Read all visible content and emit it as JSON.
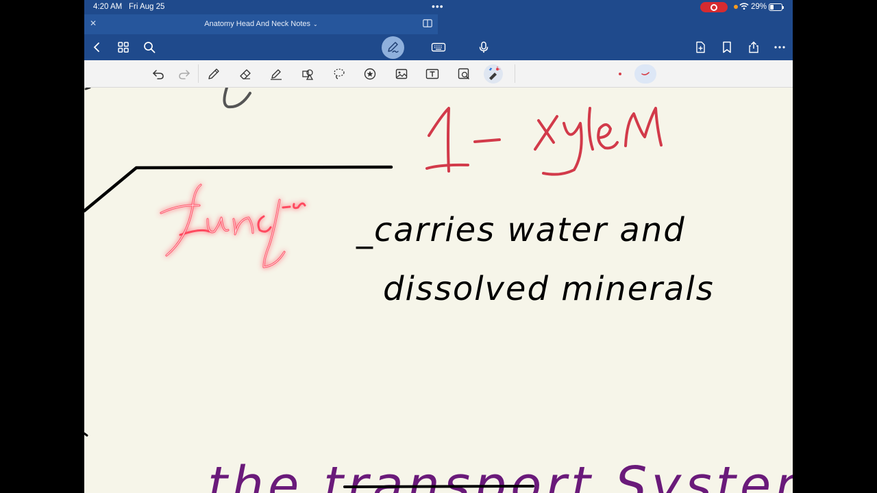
{
  "status_bar": {
    "time": "4:20 AM",
    "date": "Fri Aug 25",
    "battery_percent": "29%",
    "battery_level": 0.29,
    "recording_color": "#d62b30"
  },
  "tab": {
    "title": "Anatomy Head And Neck Notes",
    "close_icon": "close-icon",
    "chevron_icon": "chevron-down-icon"
  },
  "navbar": {
    "icons": [
      "back-icon",
      "grid-icon",
      "search-icon",
      "pen-mode-icon",
      "keyboard-icon",
      "microphone-icon",
      "add-page-icon",
      "bookmark-icon",
      "share-icon",
      "more-icon"
    ],
    "active_mode": "pen",
    "accent": "#1f4a8c"
  },
  "toolbar": {
    "tools": [
      "undo-icon",
      "redo-icon",
      "pen-icon",
      "eraser-icon",
      "highlighter-icon",
      "shapes-icon",
      "lasso-icon",
      "sticker-icon",
      "image-icon",
      "text-icon",
      "zoom-image-icon",
      "laser-pointer-icon"
    ],
    "active_tool": "laser-pointer",
    "pen_color": "#d6404a"
  },
  "note": {
    "background": "#f6f5e9",
    "heading": "1- Xylem",
    "heading_color": "#d23a4a",
    "laser_word": "Functi",
    "laser_color": "#ff4a5e",
    "line1": "_carries water and",
    "line2": "dissolved minerals",
    "ink_color": "#000000",
    "bottom_text": "the transport System",
    "bottom_color": "#6a1a7a"
  }
}
